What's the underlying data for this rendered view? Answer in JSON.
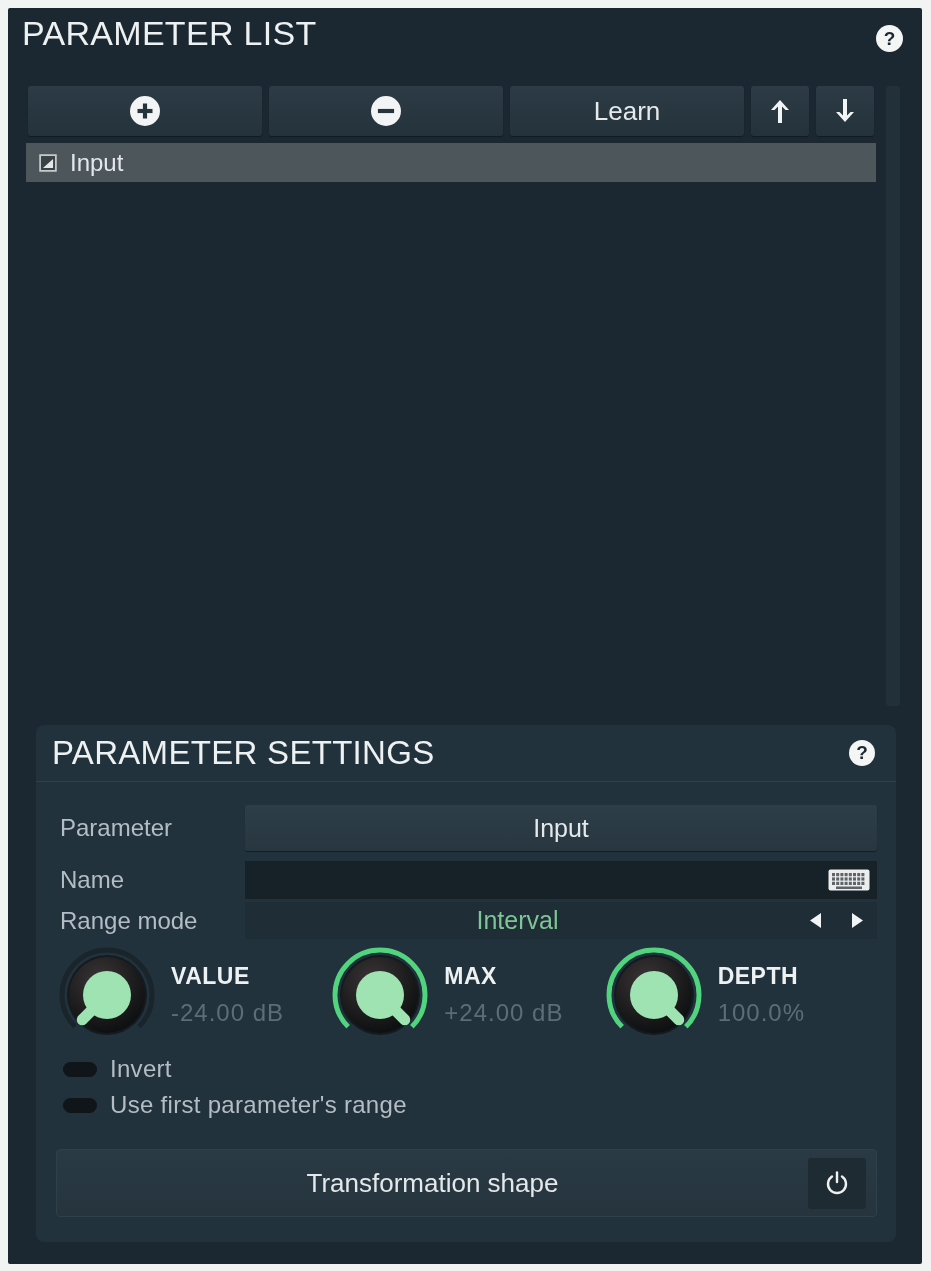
{
  "parameter_list": {
    "title": "PARAMETER LIST",
    "help": "?",
    "toolbar": [
      {
        "kind": "add"
      },
      {
        "kind": "remove"
      },
      {
        "kind": "text",
        "label": "Learn"
      },
      {
        "kind": "up"
      },
      {
        "kind": "down"
      }
    ],
    "items": [
      {
        "label": "Input",
        "checked": true,
        "selected": true
      }
    ]
  },
  "parameter_settings": {
    "title": "PARAMETER SETTINGS",
    "help": "?",
    "fields": [
      {
        "kind": "button",
        "label": "Parameter",
        "value": "Input"
      },
      {
        "kind": "text",
        "label": "Name"
      },
      {
        "kind": "selector",
        "label": "Range mode",
        "value": "Interval"
      }
    ],
    "knobs": [
      {
        "label": "VALUE",
        "reading": "-24.00 dB",
        "level": 0
      },
      {
        "label": "MAX",
        "reading": "+24.00 dB",
        "level": 1
      },
      {
        "label": "DEPTH",
        "reading": "100.0%",
        "level": 1
      }
    ],
    "toggles": [
      {
        "label": "Invert",
        "on": false
      },
      {
        "label": "Use first parameter's range",
        "on": false
      }
    ],
    "shape_button": {
      "label": "Transformation shape"
    }
  }
}
